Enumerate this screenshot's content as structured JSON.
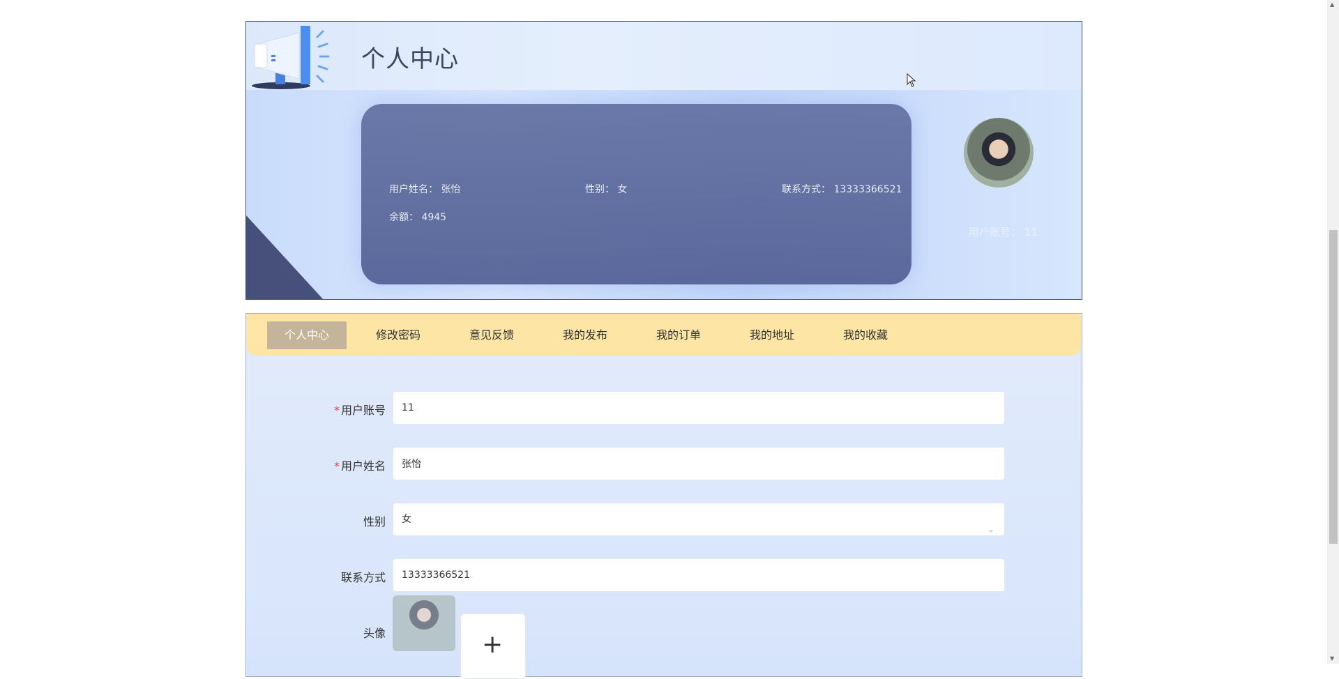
{
  "header": {
    "title": "个人中心"
  },
  "profile_card": {
    "name_label": "用户姓名：",
    "name_value": "张怡",
    "gender_label": "性别：",
    "gender_value": "女",
    "contact_label": "联系方式：",
    "contact_value": "13333366521",
    "balance_label": "余额：",
    "balance_value": "4945",
    "account_label": "用户账号：",
    "account_value": "11"
  },
  "tabs": [
    {
      "label": "个人中心",
      "active": true
    },
    {
      "label": "修改密码"
    },
    {
      "label": "意见反馈"
    },
    {
      "label": "我的发布"
    },
    {
      "label": "我的订单"
    },
    {
      "label": "我的地址"
    },
    {
      "label": "我的收藏"
    }
  ],
  "form": {
    "account": {
      "label": "用户账号",
      "required_mark": "*",
      "value": "11"
    },
    "name": {
      "label": "用户姓名",
      "required_mark": "*",
      "value": "张怡"
    },
    "gender": {
      "label": "性别",
      "value": "女"
    },
    "contact": {
      "label": "联系方式",
      "value": "13333366521"
    },
    "avatar": {
      "label": "头像",
      "upload_symbol": "+"
    }
  },
  "icons": {
    "megaphone": "megaphone-icon",
    "chevron": "chevron-down-icon",
    "plus": "plus-icon",
    "cursor": "cursor-icon"
  },
  "colors": {
    "tab_bar": "#fde5a6",
    "active_tab": "#c3b49a",
    "card": "#6270a2",
    "required": "#e04646"
  }
}
